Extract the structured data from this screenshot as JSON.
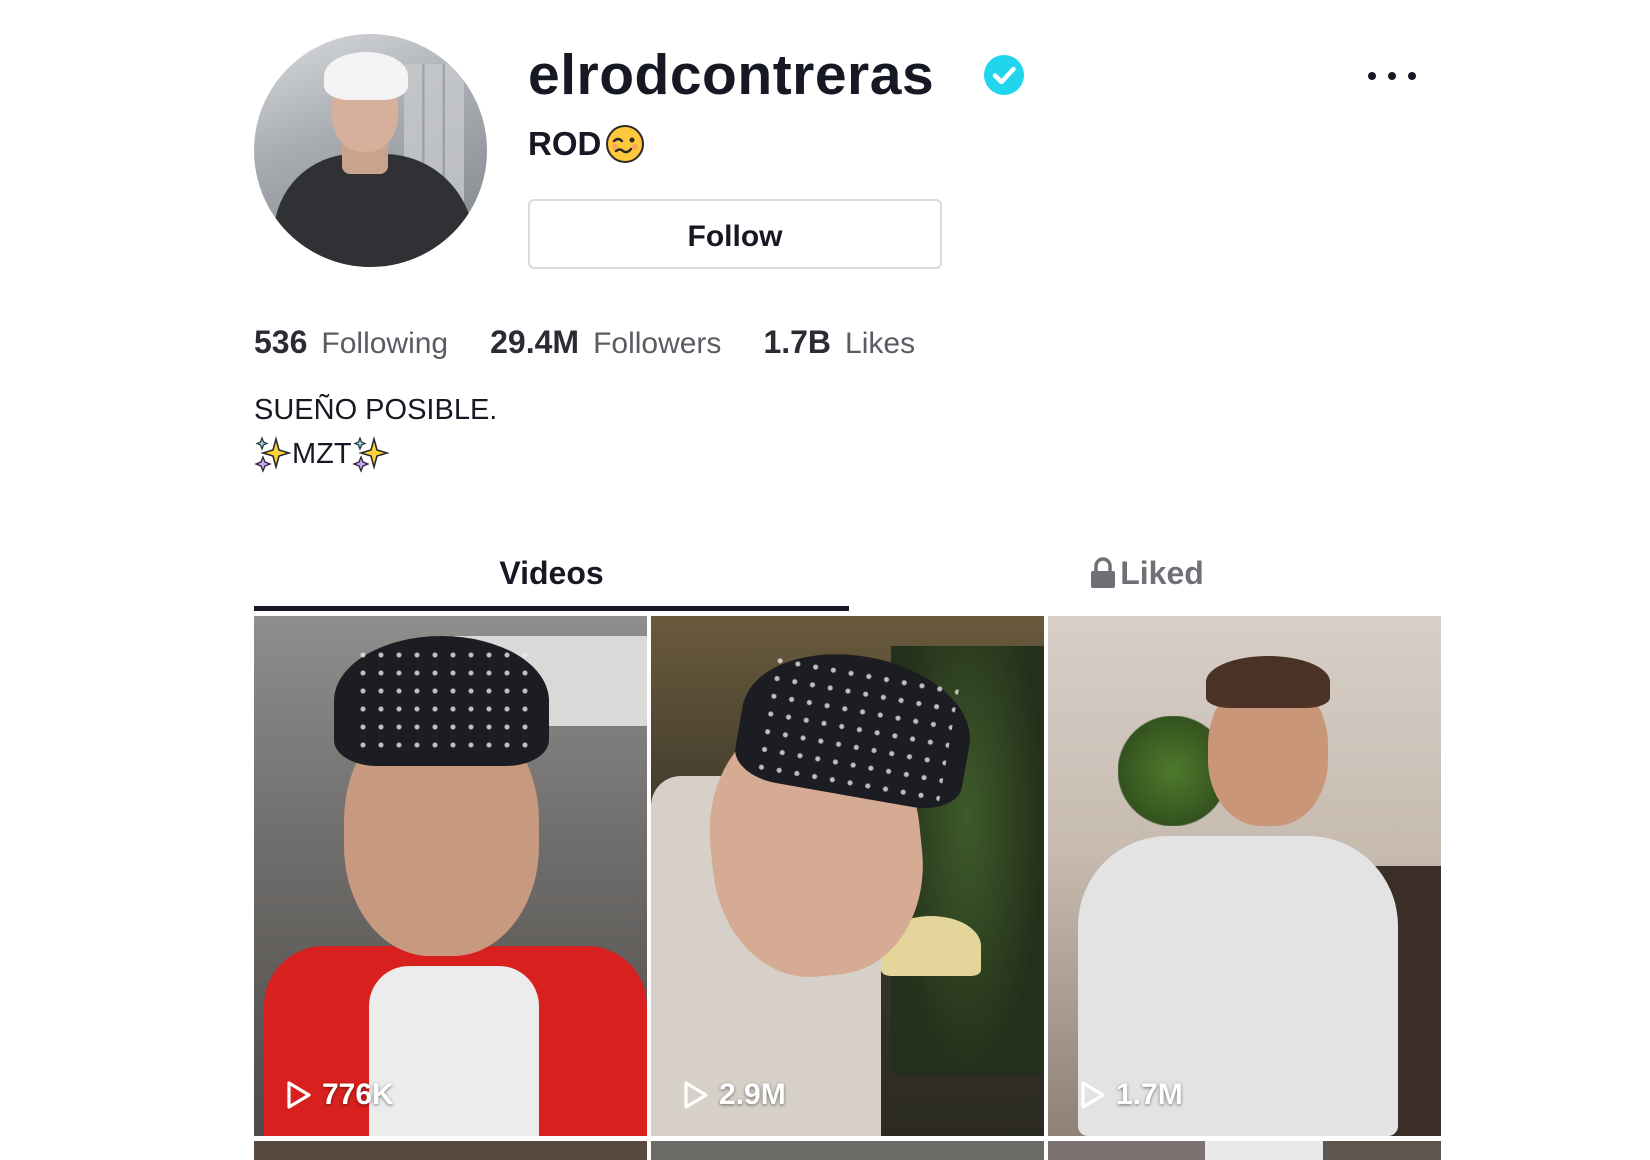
{
  "profile": {
    "username": "elrodcontreras",
    "nickname": "ROD",
    "verified": true,
    "follow_label": "Follow",
    "stats": {
      "following_count": "536",
      "following_label": "Following",
      "followers_count": "29.4M",
      "followers_label": "Followers",
      "likes_count": "1.7B",
      "likes_label": "Likes"
    },
    "bio": {
      "line1": "SUEÑO POSIBLE.",
      "line2": "MZT"
    }
  },
  "tabs": {
    "videos_label": "Videos",
    "liked_label": "Liked",
    "active": "videos"
  },
  "videos": [
    {
      "views": "776K"
    },
    {
      "views": "2.9M"
    },
    {
      "views": "1.7M"
    }
  ],
  "colors": {
    "text": "#161823",
    "verified_badge": "#20d5ec",
    "muted": "#5b5c63",
    "border": "#d9dadd"
  },
  "icons": {
    "verified": "verified-badge-icon",
    "more": "more-options-icon",
    "lock": "lock-icon",
    "play": "play-icon",
    "nickname_emoji": "woozy-face-emoji-icon",
    "bio_emoji": "sparkles-emoji-icon"
  }
}
